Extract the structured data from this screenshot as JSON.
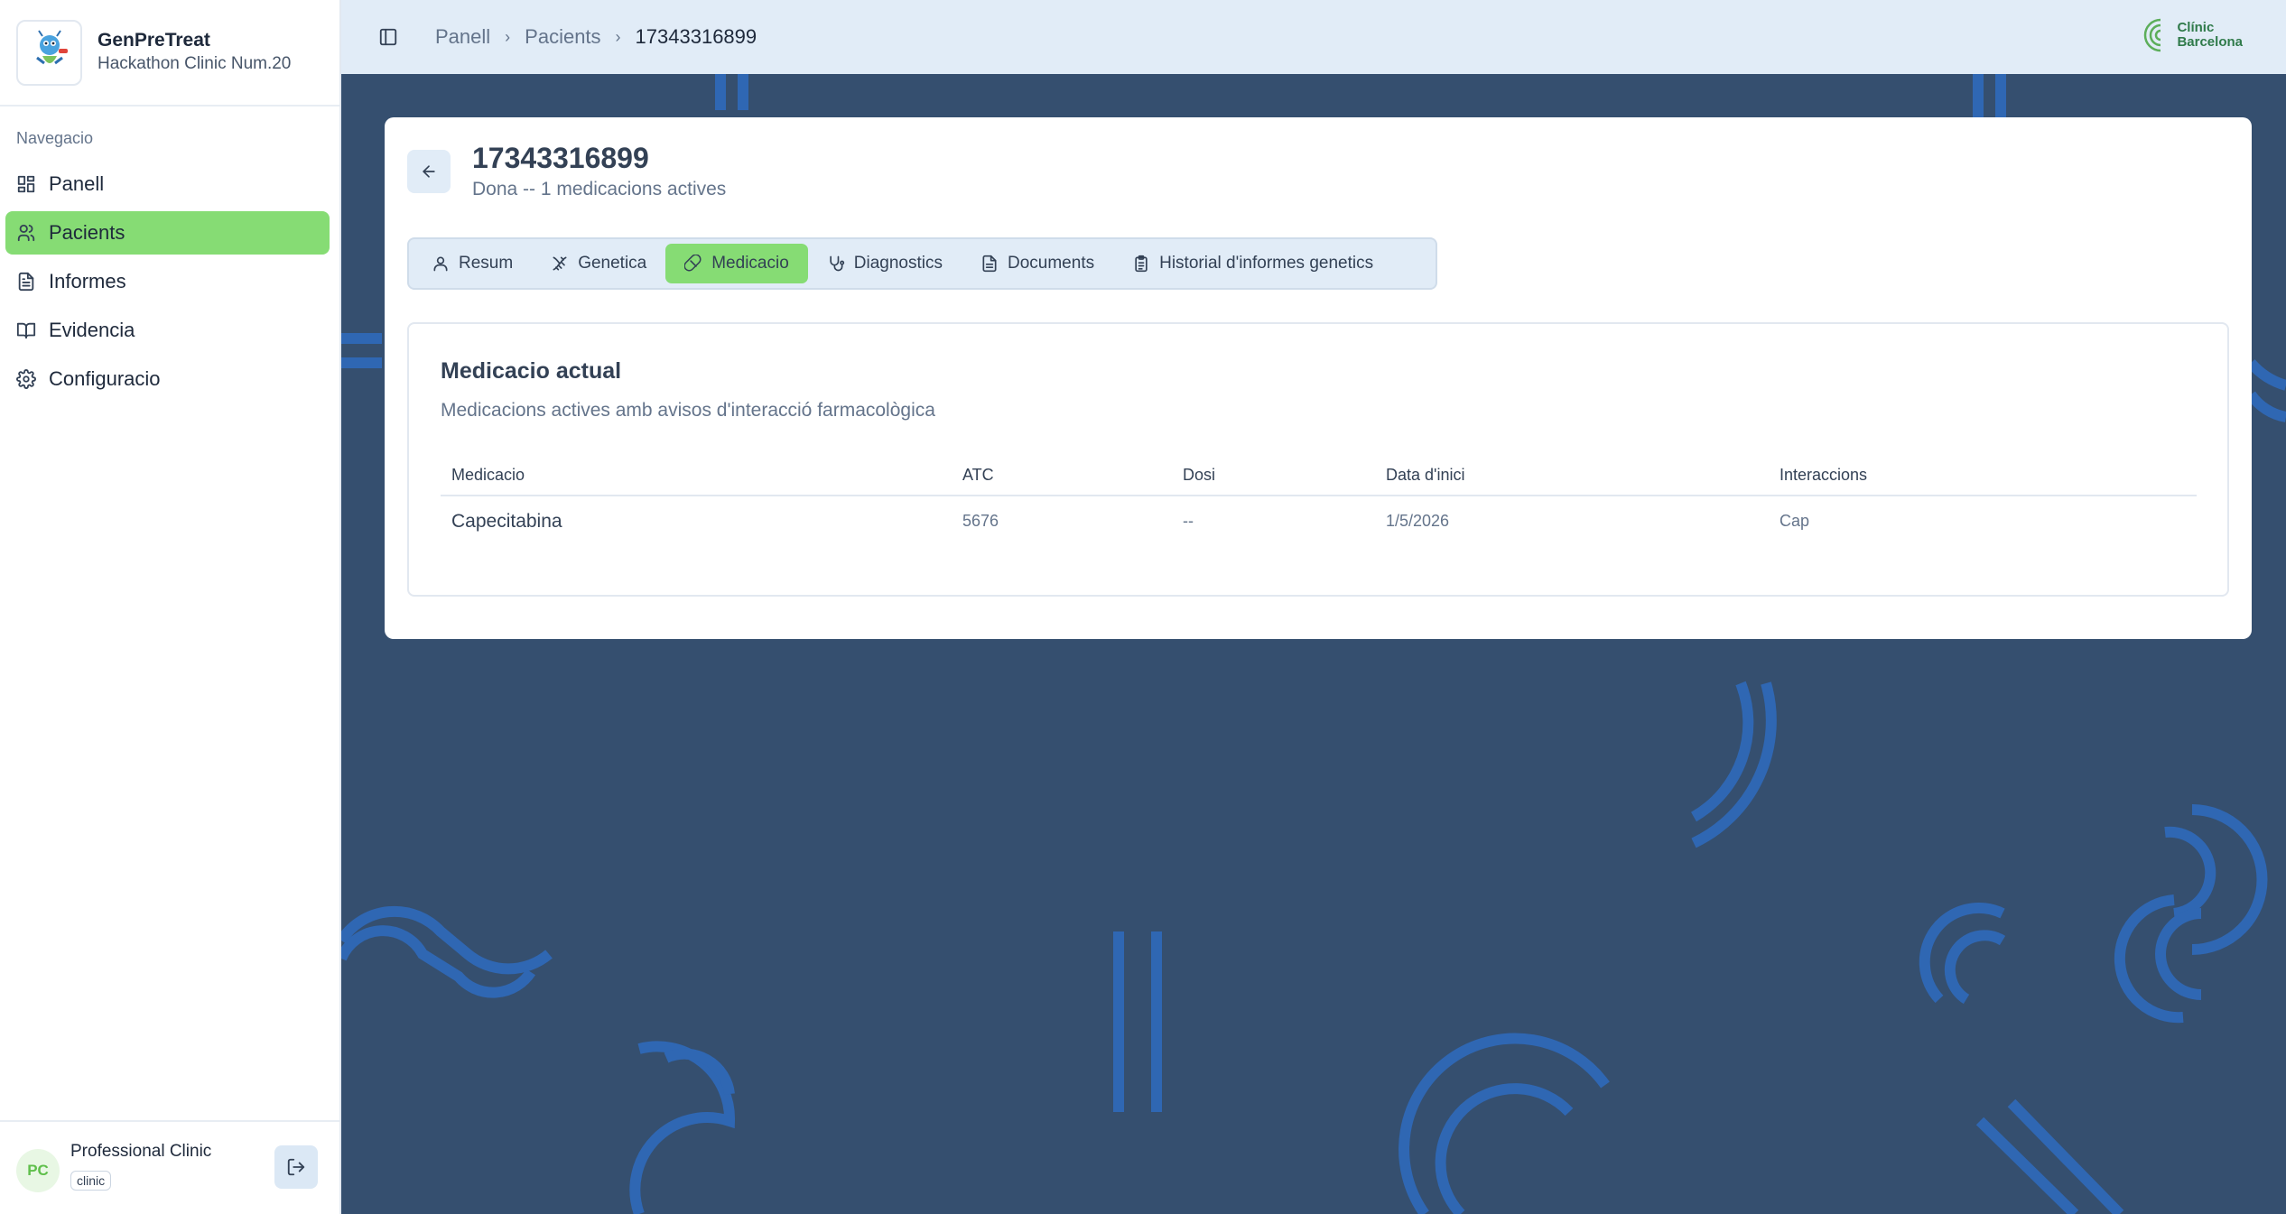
{
  "brand": {
    "name": "GenPreTreat",
    "subtitle": "Hackathon Clinic Num.20"
  },
  "sidebar": {
    "section_label": "Navegacio",
    "items": [
      {
        "label": "Panell",
        "icon": "dashboard-icon"
      },
      {
        "label": "Pacients",
        "icon": "users-icon",
        "active": true
      },
      {
        "label": "Informes",
        "icon": "file-text-icon"
      },
      {
        "label": "Evidencia",
        "icon": "book-icon"
      },
      {
        "label": "Configuracio",
        "icon": "gear-icon"
      }
    ]
  },
  "user": {
    "initials": "PC",
    "name": "Professional Clinic",
    "role": "clinic"
  },
  "breadcrumb": [
    "Panell",
    "Pacients",
    "17343316899"
  ],
  "clinic_logo": {
    "line1": "Clínic",
    "line2": "Barcelona"
  },
  "patient": {
    "id": "17343316899",
    "subtitle": "Dona -- 1 medicacions actives"
  },
  "tabs": [
    {
      "label": "Resum",
      "icon": "user-icon"
    },
    {
      "label": "Genetica",
      "icon": "dna-icon"
    },
    {
      "label": "Medicacio",
      "icon": "pill-icon",
      "active": true
    },
    {
      "label": "Diagnostics",
      "icon": "stethoscope-icon"
    },
    {
      "label": "Documents",
      "icon": "document-icon"
    },
    {
      "label": "Historial d'informes genetics",
      "icon": "clipboard-icon"
    }
  ],
  "medication": {
    "title": "Medicacio actual",
    "subtitle": "Medicacions actives amb avisos d'interacció farmacològica",
    "columns": [
      "Medicacio",
      "ATC",
      "Dosi",
      "Data d'inici",
      "Interaccions"
    ],
    "rows": [
      [
        "Capecitabina",
        "5676",
        "--",
        "1/5/2026",
        "Cap"
      ]
    ]
  },
  "colors": {
    "accent": "#86dc74",
    "background": "#354f6f",
    "topbar": "#e1ecf7"
  }
}
